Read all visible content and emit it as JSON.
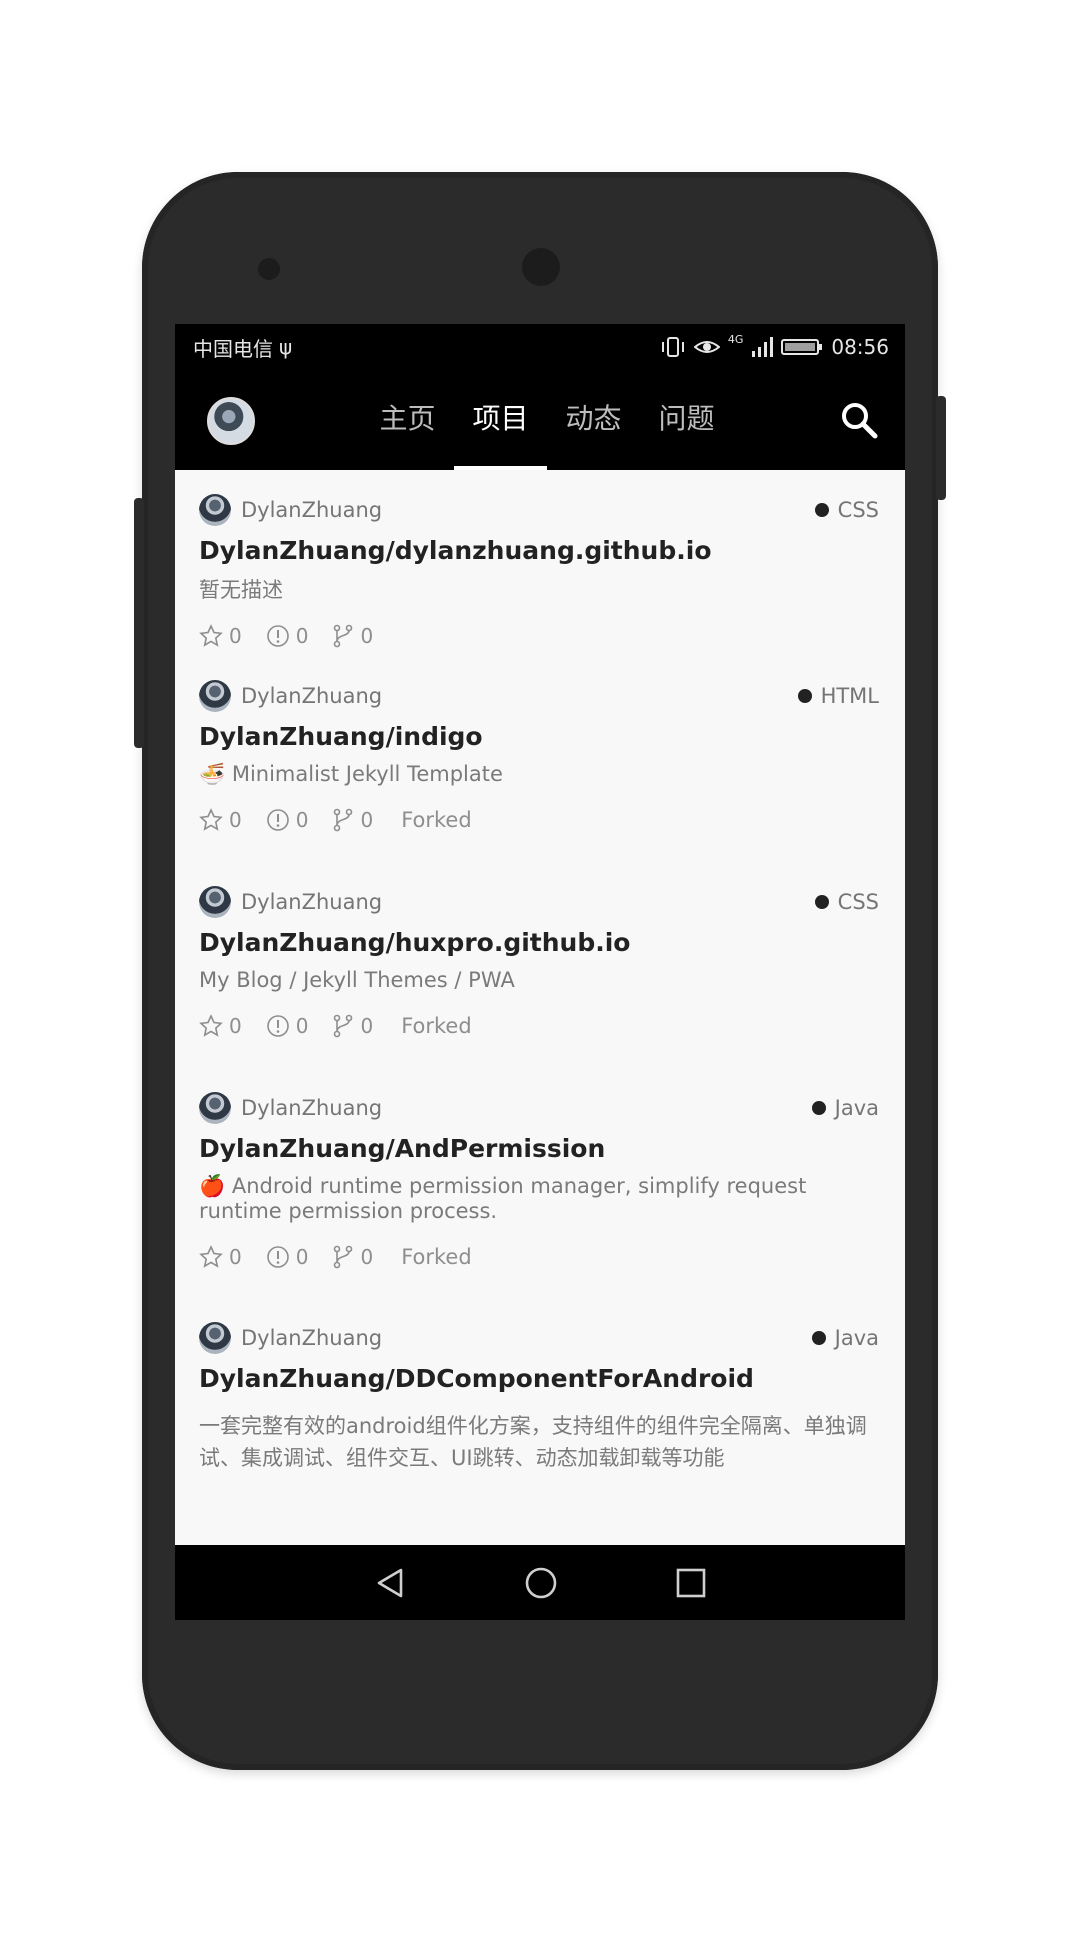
{
  "status_bar": {
    "carrier": "中国电信",
    "usb_icon": "usb-icon",
    "network": "4G",
    "time": "08:56"
  },
  "app_bar": {
    "avatar_icon": "avatar",
    "tabs": [
      {
        "label": "主页",
        "active": false
      },
      {
        "label": "项目",
        "active": true
      },
      {
        "label": "动态",
        "active": false
      },
      {
        "label": "问题",
        "active": false
      }
    ],
    "search_icon": "search-icon"
  },
  "repos": [
    {
      "owner": "DylanZhuang",
      "language": "CSS",
      "name": "DylanZhuang/dylanzhuang.github.io",
      "description": "暂无描述",
      "stars": "0",
      "issues": "0",
      "forks": "0",
      "forked": ""
    },
    {
      "owner": "DylanZhuang",
      "language": "HTML",
      "name": "DylanZhuang/indigo",
      "description": "🍜 Minimalist Jekyll Template",
      "stars": "0",
      "issues": "0",
      "forks": "0",
      "forked": "Forked"
    },
    {
      "owner": "DylanZhuang",
      "language": "CSS",
      "name": "DylanZhuang/huxpro.github.io",
      "description": "My Blog / Jekyll Themes / PWA",
      "stars": "0",
      "issues": "0",
      "forks": "0",
      "forked": "Forked"
    },
    {
      "owner": "DylanZhuang",
      "language": "Java",
      "name": "DylanZhuang/AndPermission",
      "description": "🍎 Android runtime permission manager, simplify request runtime permission process.",
      "stars": "0",
      "issues": "0",
      "forks": "0",
      "forked": "Forked"
    },
    {
      "owner": "DylanZhuang",
      "language": "Java",
      "name": "DylanZhuang/DDComponentForAndroid",
      "description": "一套完整有效的android组件化方案，支持组件的组件完全隔离、单独调试、集成调试、组件交互、UI跳转、动态加载卸载等功能",
      "stars": "",
      "issues": "",
      "forks": "",
      "forked": ""
    }
  ],
  "nav_bar": {
    "back_icon": "back-icon",
    "home_icon": "home-icon",
    "recents_icon": "recents-icon"
  },
  "colors": {
    "app_bar": "#000000",
    "list_bg": "#f8f8f8",
    "device_body": "#2b2b2b"
  }
}
